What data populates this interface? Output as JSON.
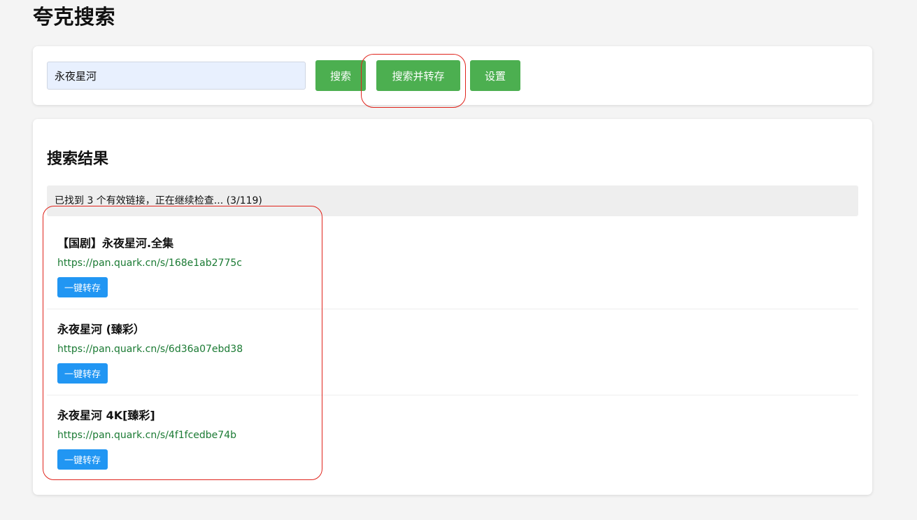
{
  "app": {
    "title": "夸克搜索"
  },
  "search": {
    "value": "永夜星河",
    "search_button": "搜索",
    "search_and_save_button": "搜索并转存",
    "settings_button": "设置"
  },
  "results": {
    "heading": "搜索结果",
    "status": "已找到 3 个有效链接，正在继续检查... (3/119)",
    "items": [
      {
        "title": "【国剧】永夜星河.全集",
        "url": "https://pan.quark.cn/s/168e1ab2775c",
        "save_button": "一键转存"
      },
      {
        "title": "永夜星河 (臻彩）",
        "url": "https://pan.quark.cn/s/6d36a07ebd38",
        "save_button": "一键转存"
      },
      {
        "title": "永夜星河 4K[臻彩]",
        "url": "https://pan.quark.cn/s/4f1fcedbe74b",
        "save_button": "一键转存"
      }
    ]
  },
  "colors": {
    "primary_green": "#4caf50",
    "save_blue": "#2196f3",
    "link_green": "#1a7a33",
    "annotation_red": "#e0241c"
  }
}
